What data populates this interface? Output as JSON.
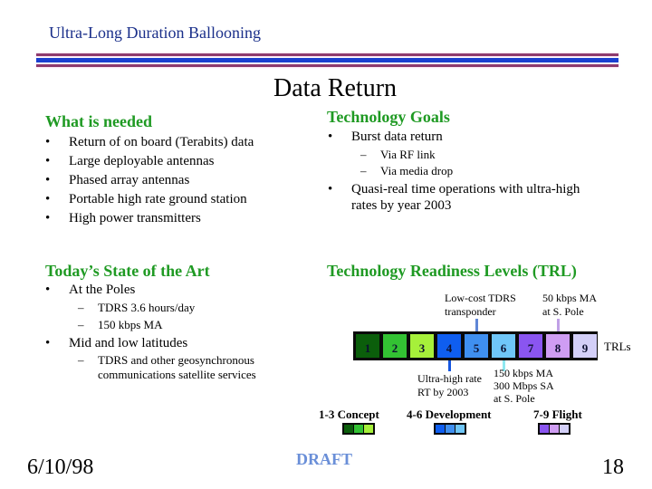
{
  "header": {
    "title": "Ultra-Long Duration Ballooning",
    "rule_colors": {
      "outer": "#8e3a6e",
      "middle": "#1a3fd0"
    }
  },
  "slide_title": "Data Return",
  "what_is_needed": {
    "heading": "What is needed",
    "items": [
      "Return of on board (Terabits) data",
      "Large deployable antennas",
      "Phased array antennas",
      "Portable high rate ground station",
      "High power transmitters"
    ]
  },
  "technology_goals": {
    "heading": "Technology Goals",
    "items": [
      {
        "text": "Burst data return",
        "sub": [
          "Via RF link",
          "Via media drop"
        ]
      },
      {
        "text_lines": [
          "Quasi-real time operations with ultra-high",
          "rates by year 2003"
        ]
      }
    ]
  },
  "state_of_art": {
    "heading": "Today’s State of the Art",
    "items": [
      {
        "text": "At the Poles",
        "sub": [
          "TDRS 3.6 hours/day",
          "150 kbps MA"
        ]
      },
      {
        "text": "Mid and low latitudes",
        "sub_lines": [
          "TDRS and other geosynchronous",
          "communications satellite services"
        ]
      }
    ]
  },
  "trl": {
    "heading": "Technology Readiness Levels (TRL)",
    "axis_label": "TRLs",
    "levels": [
      {
        "n": "1",
        "color": "#0b5e0b"
      },
      {
        "n": "2",
        "color": "#33c233"
      },
      {
        "n": "3",
        "color": "#a6f03a"
      },
      {
        "n": "4",
        "color": "#0f5ef0"
      },
      {
        "n": "5",
        "color": "#3f8ff0"
      },
      {
        "n": "6",
        "color": "#6fc6f8"
      },
      {
        "n": "7",
        "color": "#8a55f0"
      },
      {
        "n": "8",
        "color": "#cf9df3"
      },
      {
        "n": "9",
        "color": "#d3cff8"
      }
    ],
    "callouts_above": [
      {
        "level": 5,
        "lines": [
          "Low-cost TDRS",
          "transponder"
        ],
        "color": "#5f86d6"
      },
      {
        "level": 8,
        "lines": [
          "50 kbps MA",
          "at  S. Pole"
        ],
        "color": "#c0a0e6"
      }
    ],
    "callouts_below": [
      {
        "level": 4,
        "lines": [
          "Ultra-high rate",
          "RT by 2003"
        ],
        "color": "#1556e0"
      },
      {
        "level": 6,
        "lines": [
          "150 kbps MA",
          "300 Mbps SA",
          "at S. Pole"
        ],
        "color": "#8ee8f0"
      }
    ],
    "legend": [
      {
        "label": "1-3  Concept",
        "levels": [
          1,
          2,
          3
        ]
      },
      {
        "label": "4-6  Development",
        "levels": [
          4,
          5,
          6
        ]
      },
      {
        "label": "7-9  Flight",
        "levels": [
          7,
          8,
          9
        ]
      }
    ]
  },
  "footer": {
    "date": "6/10/98",
    "draft": "DRAFT",
    "page": "18"
  }
}
